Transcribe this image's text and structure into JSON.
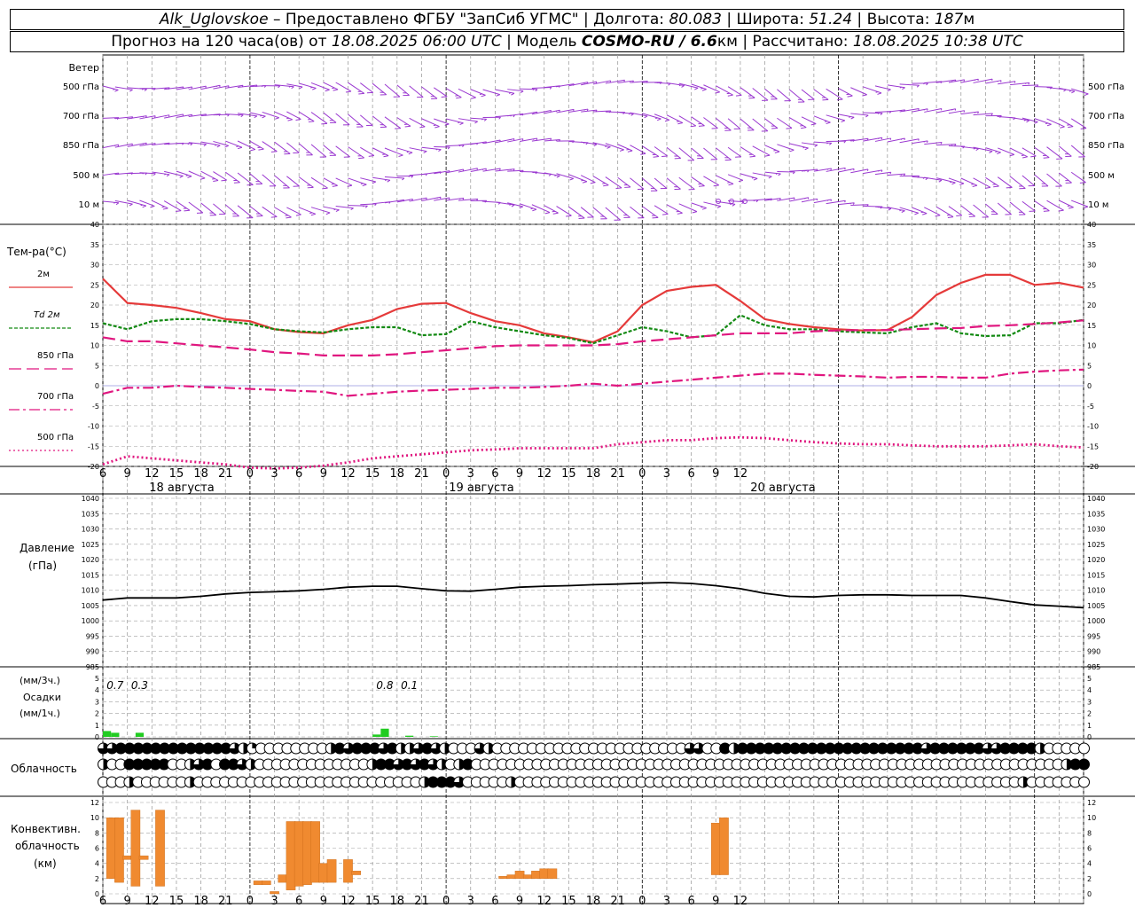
{
  "header": {
    "station": "Alk_Uglovskoe",
    "provider": "Предоставлено ФГБУ \"ЗапСиб УГМС\"",
    "lon_label": "Долгота:",
    "lon": "80.083",
    "lat_label": "Широта:",
    "lat": "51.24",
    "alt_label": "Высота:",
    "alt": "187",
    "alt_unit": "м",
    "forecast_label": "Прогноз на 120 часа(ов) от",
    "forecast_start": "18.08.2025 06:00 UTC",
    "model_label": "Модель",
    "model": "COSMO-RU / 6.6",
    "model_unit": "км",
    "computed_label": "Рассчитано:",
    "computed": "18.08.2025 10:38 UTC"
  },
  "colors": {
    "wind": "#9a38d0",
    "t2m": "#e53a3a",
    "td2m": "#138a13",
    "t850": "#e0167f",
    "precip": "#22cc22",
    "conv": "#f08a30",
    "grid": "#a0a0a0"
  },
  "chart_data": [
    {
      "type": "line",
      "title": "Ветер",
      "levels": [
        "500 гПа",
        "700 гПа",
        "850 гПа",
        "500 м",
        "10 м"
      ],
      "right_levels": [
        "500 гПа",
        "700 гПа",
        "850 гПа",
        "500 м",
        "10 м"
      ],
      "grid": true
    },
    {
      "type": "line",
      "ylabel": "Тем-ра(°C)",
      "ylim": [
        -20,
        40
      ],
      "yticks": [
        "40",
        "35",
        "30",
        "25",
        "20",
        "15",
        "10",
        "5",
        "0",
        "-5",
        "-10",
        "-15",
        "-20"
      ],
      "x_hours": [
        0,
        3,
        6,
        9,
        12,
        15,
        18,
        21,
        24,
        27,
        30,
        33,
        36,
        39,
        42,
        45,
        48,
        51,
        54,
        57,
        60,
        63,
        66,
        69,
        72,
        75,
        78,
        81,
        84,
        87,
        90,
        93,
        96,
        99,
        102,
        105,
        108,
        111,
        114,
        117,
        120
      ],
      "xticks": [
        "6",
        "9",
        "12",
        "15",
        "18",
        "21",
        "0",
        "3",
        "6",
        "9",
        "12",
        "15",
        "18",
        "21",
        "0",
        "3",
        "6",
        "9",
        "12",
        "15",
        "18",
        "21",
        "0",
        "3",
        "6",
        "9",
        "12"
      ],
      "days": [
        "18 августа",
        "19 августа",
        "20 августа"
      ],
      "series": [
        {
          "name": "2м",
          "values": [
            26.5,
            20.5,
            20,
            19.3,
            18,
            16.5,
            16,
            14,
            13.3,
            13,
            15,
            16.3,
            19,
            20.3,
            20.5,
            18,
            16,
            15,
            13,
            12,
            10.8,
            13.5,
            20,
            23.5,
            24.5,
            25,
            21,
            16.5,
            15.3,
            14.5,
            14,
            13.7,
            13.8,
            17,
            22.5,
            25.5,
            27.5,
            27.5,
            25,
            25.5,
            24.3
          ]
        },
        {
          "name": "Td 2м",
          "values": [
            15.5,
            14,
            16,
            16.5,
            16.5,
            16,
            15.3,
            14,
            13.5,
            13.2,
            14,
            14.5,
            14.5,
            12.5,
            12.8,
            16,
            14.5,
            13.5,
            12.5,
            11.8,
            10.5,
            12.5,
            14.5,
            13.5,
            12,
            12.5,
            17.5,
            15,
            14,
            14,
            13.5,
            13.2,
            13,
            14.5,
            15.5,
            13,
            12.3,
            12.5,
            15.5,
            15.5,
            16.3
          ]
        },
        {
          "name": "850 гПа",
          "values": [
            12,
            11,
            11,
            10.5,
            10,
            9.5,
            9,
            8.3,
            8,
            7.5,
            7.5,
            7.5,
            7.8,
            8.3,
            8.8,
            9.3,
            9.8,
            10,
            10,
            10,
            10,
            10.3,
            11,
            11.5,
            12,
            12.5,
            13,
            13,
            13,
            13.5,
            13.7,
            13.8,
            13.8,
            14,
            14.2,
            14.3,
            14.8,
            15,
            15.3,
            15.7,
            16.2
          ]
        },
        {
          "name": "700 гПа",
          "values": [
            -2,
            -0.5,
            -0.5,
            0,
            -0.3,
            -0.5,
            -0.8,
            -1,
            -1.3,
            -1.5,
            -2.5,
            -2,
            -1.5,
            -1.2,
            -1,
            -0.8,
            -0.5,
            -0.5,
            -0.3,
            0,
            0.5,
            0,
            0.5,
            1,
            1.5,
            2,
            2.5,
            3,
            3,
            2.7,
            2.5,
            2.3,
            2,
            2.2,
            2.2,
            2,
            2,
            3,
            3.5,
            3.8,
            4
          ]
        },
        {
          "name": "500 гПа",
          "values": [
            -19.5,
            -17.5,
            -18,
            -18.5,
            -19,
            -19.5,
            -20.3,
            -20.5,
            -20.3,
            -19.8,
            -19,
            -18,
            -17.5,
            -17,
            -16.5,
            -16,
            -15.8,
            -15.5,
            -15.5,
            -15.5,
            -15.5,
            -14.5,
            -14,
            -13.5,
            -13.5,
            -13,
            -12.8,
            -13,
            -13.5,
            -14,
            -14.3,
            -14.5,
            -14.5,
            -14.8,
            -15,
            -15,
            -15,
            -14.8,
            -14.5,
            -15,
            -15.3
          ]
        }
      ],
      "grid": true
    },
    {
      "type": "line",
      "ylabel": "Давление",
      "yunit": "(гПа)",
      "ylim": [
        985,
        1040
      ],
      "yticks": [
        "1040",
        "1035",
        "1030",
        "1025",
        "1020",
        "1015",
        "1010",
        "1005",
        "1000",
        "995",
        "990",
        "985"
      ],
      "x_hours": [
        0,
        3,
        6,
        9,
        12,
        15,
        18,
        21,
        24,
        27,
        30,
        33,
        36,
        39,
        42,
        45,
        48,
        51,
        54,
        57,
        60,
        63,
        66,
        69,
        72,
        75,
        78,
        81,
        84,
        87,
        90,
        93,
        96,
        99,
        102,
        105,
        108,
        111,
        114,
        117,
        120
      ],
      "values": [
        1006.8,
        1007.5,
        1007.5,
        1007.5,
        1008,
        1008.8,
        1009.3,
        1009.5,
        1009.8,
        1010.3,
        1011,
        1011.3,
        1011.3,
        1010.5,
        1009.8,
        1009.7,
        1010.3,
        1011,
        1011.3,
        1011.5,
        1011.8,
        1012,
        1012.3,
        1012.5,
        1012.2,
        1011.5,
        1010.5,
        1009,
        1008,
        1007.8,
        1008.3,
        1008.5,
        1008.5,
        1008.3,
        1008.3,
        1008.3,
        1007.5,
        1006.3,
        1005.2,
        1004.8,
        1004.3
      ],
      "grid": true
    },
    {
      "type": "bar",
      "ylabel": "Осадки",
      "yunit_top": "(мм/3ч.)",
      "yunit_bottom": "(мм/1ч.)",
      "ylim": [
        0,
        5
      ],
      "yticks": [
        "5",
        "4",
        "3",
        "2",
        "1",
        "0"
      ],
      "labels_3h": [
        {
          "hour": 1.5,
          "text": "0.7"
        },
        {
          "hour": 4.5,
          "text": "0.3"
        },
        {
          "hour": 34.5,
          "text": "0.8"
        },
        {
          "hour": 37.5,
          "text": "0.1"
        }
      ],
      "bars_1h": [
        {
          "hour": 0,
          "value": 0.5
        },
        {
          "hour": 1,
          "value": 0.35
        },
        {
          "hour": 4,
          "value": 0.35
        },
        {
          "hour": 33,
          "value": 0.2
        },
        {
          "hour": 34,
          "value": 0.7
        },
        {
          "hour": 37,
          "value": 0.1
        },
        {
          "hour": 40,
          "value": 0.05
        }
      ],
      "grid": true
    },
    {
      "type": "table",
      "ylabel": "Облачность",
      "rows": [
        [
          6,
          6,
          8,
          8,
          8,
          8,
          8,
          8,
          8,
          8,
          8,
          8,
          8,
          8,
          8,
          6,
          4,
          2,
          0,
          0,
          0,
          0,
          0,
          0,
          0,
          0,
          4,
          8,
          6,
          8,
          8,
          8,
          6,
          8,
          4,
          4,
          6,
          8,
          6,
          4,
          0,
          0,
          0,
          6,
          4,
          0,
          0,
          0,
          0,
          0,
          0,
          0,
          0,
          0,
          0,
          0,
          0,
          0,
          0,
          0,
          0,
          0,
          0,
          0,
          0,
          0,
          0,
          6,
          6,
          0,
          0,
          8,
          4,
          8,
          8,
          8,
          8,
          8,
          8,
          8,
          8,
          8,
          8,
          8,
          8,
          8,
          8,
          8,
          8,
          8,
          8,
          8,
          8,
          8,
          6,
          8,
          8,
          8,
          8,
          8,
          8,
          6,
          6,
          8,
          8,
          8,
          8,
          4,
          0,
          0,
          0,
          0,
          0
        ],
        [
          4,
          0,
          0,
          8,
          8,
          8,
          8,
          8,
          0,
          0,
          4,
          6,
          8,
          0,
          8,
          8,
          6,
          4,
          0,
          0,
          0,
          0,
          0,
          0,
          0,
          0,
          0,
          0,
          0,
          0,
          0,
          4,
          8,
          8,
          6,
          8,
          6,
          8,
          6,
          4,
          0,
          4,
          8,
          0,
          0,
          0,
          0,
          0,
          0,
          0,
          0,
          0,
          0,
          0,
          0,
          0,
          0,
          0,
          0,
          0,
          0,
          0,
          0,
          0,
          0,
          0,
          0,
          0,
          0,
          0,
          0,
          0,
          0,
          0,
          0,
          0,
          0,
          0,
          0,
          0,
          0,
          0,
          0,
          0,
          0,
          0,
          0,
          0,
          0,
          0,
          0,
          0,
          0,
          0,
          0,
          0,
          0,
          0,
          0,
          0,
          0,
          0,
          0,
          0,
          0,
          0,
          0,
          0,
          0,
          0,
          0,
          4,
          8,
          8
        ],
        [
          0,
          0,
          0,
          4,
          0,
          0,
          0,
          0,
          0,
          0,
          4,
          0,
          0,
          0,
          0,
          0,
          0,
          0,
          0,
          0,
          0,
          0,
          0,
          0,
          0,
          0,
          0,
          0,
          0,
          0,
          0,
          0,
          0,
          0,
          0,
          0,
          0,
          4,
          8,
          8,
          8,
          6,
          0,
          0,
          0,
          0,
          0,
          4,
          0,
          0,
          0,
          0,
          0,
          0,
          0,
          0,
          0,
          0,
          0,
          0,
          0,
          0,
          0,
          0,
          0,
          0,
          0,
          0,
          0,
          0,
          0,
          0,
          0,
          0,
          0,
          0,
          0,
          0,
          0,
          0,
          0,
          0,
          0,
          0,
          0,
          0,
          0,
          0,
          0,
          0,
          0,
          0,
          0,
          0,
          0,
          0,
          0,
          0,
          0,
          0,
          0,
          0,
          0,
          0,
          0,
          0,
          4,
          0,
          0,
          0,
          0,
          0,
          0,
          0
        ]
      ],
      "grid": true
    },
    {
      "type": "bar",
      "ylabel": "Конвективн. облачность (км)",
      "ylabel_lines": [
        "Конвективн.",
        "облачность",
        "(км)"
      ],
      "ylim": [
        0,
        12
      ],
      "yticks": [
        "12",
        "10",
        "8",
        "6",
        "4",
        "2",
        "0"
      ],
      "bars": [
        {
          "hour": 1,
          "base": 2,
          "top": 10
        },
        {
          "hour": 2,
          "base": 1.5,
          "top": 10
        },
        {
          "hour": 3,
          "base": 4.5,
          "top": 5
        },
        {
          "hour": 4,
          "base": 1,
          "top": 11
        },
        {
          "hour": 5,
          "base": 4.5,
          "top": 5
        },
        {
          "hour": 7,
          "base": 1,
          "top": 11
        },
        {
          "hour": 19,
          "base": 1.2,
          "top": 1.7
        },
        {
          "hour": 20,
          "base": 1.2,
          "top": 1.7
        },
        {
          "hour": 21,
          "base": 0,
          "top": 0.3
        },
        {
          "hour": 22,
          "base": 1.5,
          "top": 2.5
        },
        {
          "hour": 23,
          "base": 0.5,
          "top": 9.5
        },
        {
          "hour": 24,
          "base": 1,
          "top": 9.5
        },
        {
          "hour": 25,
          "base": 1.2,
          "top": 9.5
        },
        {
          "hour": 26,
          "base": 1.5,
          "top": 9.5
        },
        {
          "hour": 27,
          "base": 1.5,
          "top": 4
        },
        {
          "hour": 28,
          "base": 1.5,
          "top": 4.5
        },
        {
          "hour": 30,
          "base": 1.5,
          "top": 4.5
        },
        {
          "hour": 31,
          "base": 2.5,
          "top": 3
        },
        {
          "hour": 49,
          "base": 2,
          "top": 2.3
        },
        {
          "hour": 50,
          "base": 2,
          "top": 2.5
        },
        {
          "hour": 51,
          "base": 2,
          "top": 3
        },
        {
          "hour": 52,
          "base": 2,
          "top": 2.5
        },
        {
          "hour": 53,
          "base": 2,
          "top": 3
        },
        {
          "hour": 54,
          "base": 2,
          "top": 3.3
        },
        {
          "hour": 55,
          "base": 2,
          "top": 3.3
        },
        {
          "hour": 75,
          "base": 2.5,
          "top": 9.3
        },
        {
          "hour": 76,
          "base": 2.5,
          "top": 10
        }
      ],
      "grid": true
    }
  ]
}
